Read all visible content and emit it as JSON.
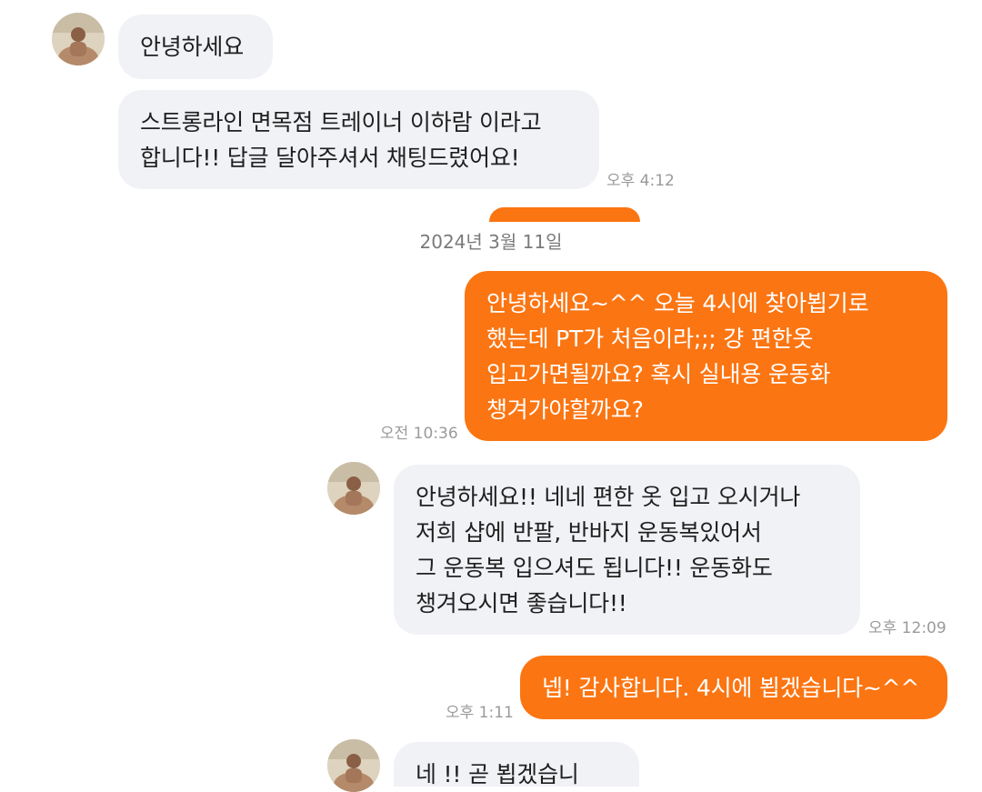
{
  "date_divider": "2024년 3월 11일",
  "colors": {
    "outgoing_bubble": "#fb7512",
    "incoming_bubble": "#f1f2f6",
    "timestamp": "#9a9a9a"
  },
  "messages": [
    {
      "direction": "incoming",
      "text": "안녕하세요"
    },
    {
      "direction": "incoming",
      "text": "스트롱라인 면목점 트레이너 이하람 이라고\n합니다!! 답글 달아주셔서 채팅드렸어요!",
      "time": "오후 4:12"
    },
    {
      "direction": "outgoing",
      "text": "안녕하세요~^^ 오늘 4시에 찾아뵙기로\n했는데 PT가 처음이라;;;  걍 편한옷\n입고가면될까요? 혹시 실내용 운동화\n챙겨가야할까요?",
      "time": "오전 10:36"
    },
    {
      "direction": "incoming",
      "text": "안녕하세요!! 네네 편한 옷 입고 오시거나\n저희 샵에 반팔, 반바지 운동복있어서\n그 운동복 입으셔도 됩니다!! 운동화도\n챙겨오시면 좋습니다!!",
      "time": "오후 12:09"
    },
    {
      "direction": "outgoing",
      "text": "넵! 감사합니다. 4시에 뵙겠습니다~^^",
      "time": "오후 1:11"
    },
    {
      "direction": "incoming",
      "text": "네 !! 곧 뵙겠습니다!!"
    }
  ],
  "avatar_icon": "user-profile-photo"
}
